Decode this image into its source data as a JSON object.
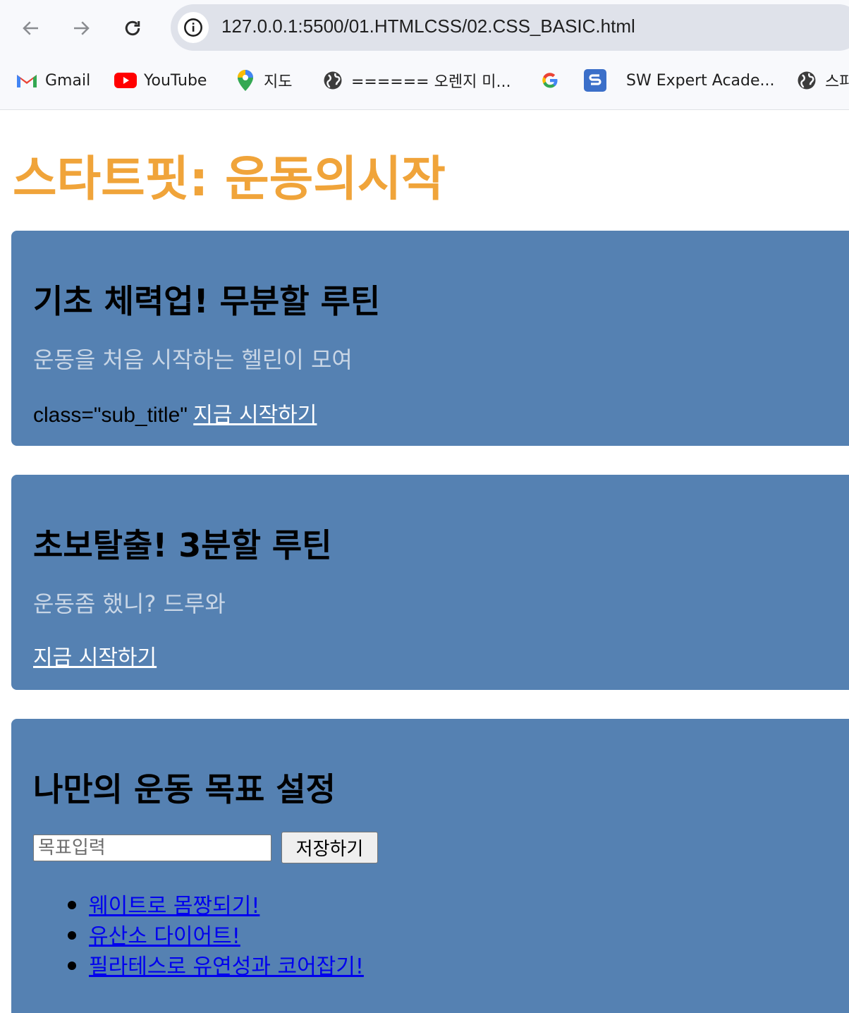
{
  "browser": {
    "url": "127.0.0.1:5500/01.HTMLCSS/02.CSS_BASIC.html",
    "bookmarks": [
      {
        "label": "Gmail",
        "icon": "gmail-icon"
      },
      {
        "label": "YouTube",
        "icon": "youtube-icon"
      },
      {
        "label": "지도",
        "icon": "maps-icon"
      },
      {
        "label": "====== 오렌지 미...",
        "icon": "globe-icon"
      },
      {
        "label": "",
        "icon": "google-icon"
      },
      {
        "label": "SW Expert Acade...",
        "icon": "swea-icon"
      },
      {
        "label": "스파",
        "icon": "globe-icon"
      }
    ]
  },
  "page": {
    "title": "스타트핏: 운동의시작",
    "cards": [
      {
        "heading": "기초 체력업! 무분할 루틴",
        "description": "운동을 처음 시작하는 헬린이 모여",
        "prefix_text": "class=\"sub_title\" ",
        "link": "지금 시작하기"
      },
      {
        "heading": "초보탈출! 3분할 루틴",
        "description": "운동좀 했니? 드루와",
        "prefix_text": "",
        "link": "지금 시작하기"
      }
    ],
    "goal_section": {
      "heading": "나만의 운동 목표 설정",
      "input_placeholder": "목표입력",
      "input_value": "",
      "save_label": "저장하기",
      "goals": [
        "웨이트로 몸짱되기!",
        "유산소 다이어트!",
        "필라테스로 유연성과 코어잡기!"
      ]
    }
  },
  "colors": {
    "title": "#f0a43a",
    "card_bg": "#5581b2",
    "description": "#c9d6e6",
    "goal_link": "#0000ee"
  }
}
